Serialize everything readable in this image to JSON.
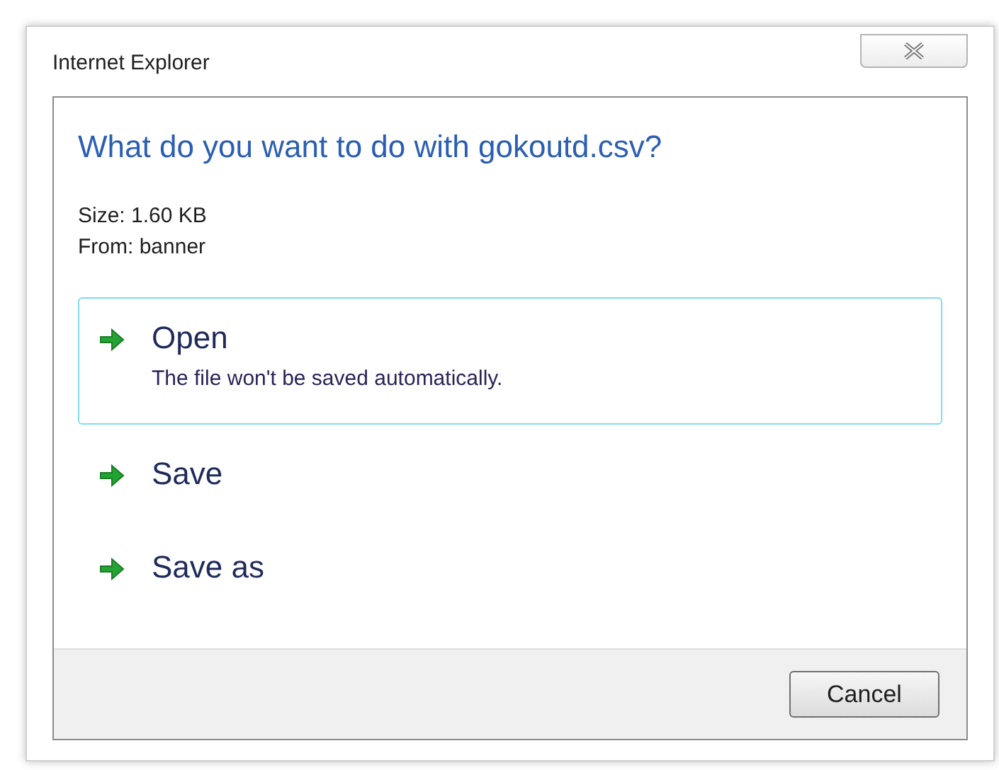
{
  "window": {
    "title": "Internet Explorer"
  },
  "heading": "What do you want to do with gokoutd.csv?",
  "details": [
    "Size: 1.60 KB",
    "From: banner"
  ],
  "options": [
    {
      "label": "Open",
      "description": "The file won't be saved automatically.",
      "selected": true
    },
    {
      "label": "Save",
      "selected": false
    },
    {
      "label": "Save as",
      "selected": false
    }
  ],
  "buttons": [
    "Cancel"
  ]
}
